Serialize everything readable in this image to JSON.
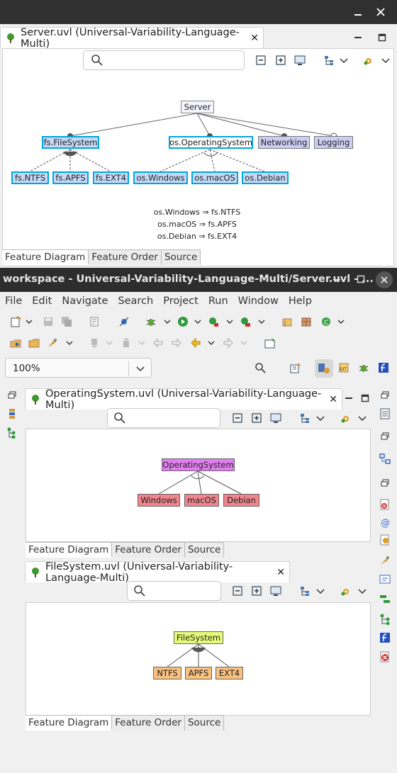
{
  "float_window": {
    "tab_title": "Server.uvl (Universal-Variability-Language-Multi)",
    "feature_diagram": {
      "root": "Server",
      "children": [
        "fs.FileSystem",
        "os.OperatingSystem",
        "Networking",
        "Logging"
      ],
      "fs_children": [
        "fs.NTFS",
        "fs.APFS",
        "fs.EXT4"
      ],
      "os_children": [
        "os.Windows",
        "os.macOS",
        "os.Debian"
      ],
      "constraints": [
        "os.Windows ⇒ fs.NTFS",
        "os.macOS ⇒ fs.APFS",
        "os.Debian ⇒ fs.EXT4"
      ]
    },
    "tabs": [
      "Feature Diagram",
      "Feature Order",
      "Source"
    ]
  },
  "main_window": {
    "title": "workspace - Universal-Variability-Language-Multi/Server.uvl - ...",
    "menu": [
      "File",
      "Edit",
      "Navigate",
      "Search",
      "Project",
      "Run",
      "Window",
      "Help"
    ],
    "zoom": "100%"
  },
  "editor_os": {
    "tab_title": "OperatingSystem.uvl (Universal-Variability-Language-Multi)",
    "root": "OperatingSystem",
    "children": [
      "Windows",
      "macOS",
      "Debian"
    ],
    "tabs": [
      "Feature Diagram",
      "Feature Order",
      "Source"
    ]
  },
  "editor_fs": {
    "tab_title": "FileSystem.uvl (Universal-Variability-Language-Multi)",
    "root": "FileSystem",
    "children": [
      "NTFS",
      "APFS",
      "EXT4"
    ],
    "tabs": [
      "Feature Diagram",
      "Feature Order",
      "Source"
    ]
  },
  "colors": {
    "concrete_blue": "#c6d8f7",
    "abstract_lavender": "#ccccf5",
    "root_white": "#f4f4ff",
    "selected_border": "#00a6e0",
    "os_root": "#e37ef2",
    "os_child": "#f0858c",
    "fs_root": "#e6fb78",
    "fs_child": "#f9c180",
    "titlebar": "#2f2f2f"
  }
}
